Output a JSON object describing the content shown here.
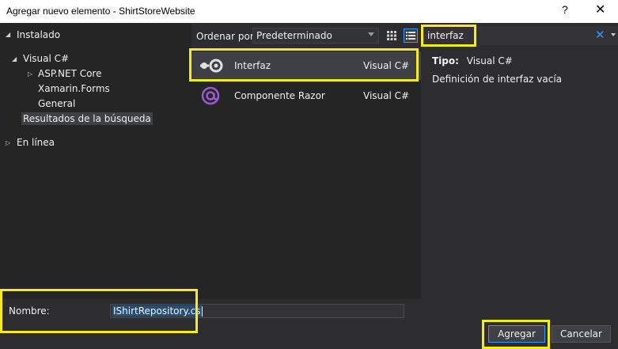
{
  "window": {
    "title": "Agregar nuevo elemento - ShirtStoreWebsite",
    "help": "?",
    "close": "✕"
  },
  "tree": {
    "installed": "Instalado",
    "visual_csharp": "Visual C#",
    "aspnet_core": "ASP.NET Core",
    "xamarin_forms": "Xamarin.Forms",
    "general": "General",
    "search_results": "Resultados de la búsqueda",
    "online": "En línea"
  },
  "toolbar": {
    "sort_label": "Ordenar por:",
    "sort_value": "Predeterminado"
  },
  "search": {
    "value": "interfaz",
    "clear": "✕"
  },
  "templates": [
    {
      "name": "Interfaz",
      "lang": "Visual C#",
      "icon": "interface-icon"
    },
    {
      "name": "Componente Razor",
      "lang": "Visual C#",
      "icon": "razor-component-icon"
    }
  ],
  "details": {
    "type_label": "Tipo:",
    "type_value": "Visual C#",
    "description": "Definición de interfaz vacía"
  },
  "footer": {
    "name_label": "Nombre:",
    "name_value": "IShirtRepository.cs",
    "add_button": "Agregar",
    "cancel_button": "Cancelar"
  },
  "colors": {
    "highlight": "#f7ec1b",
    "accent": "#3399ff",
    "razor": "#9b59d0"
  }
}
